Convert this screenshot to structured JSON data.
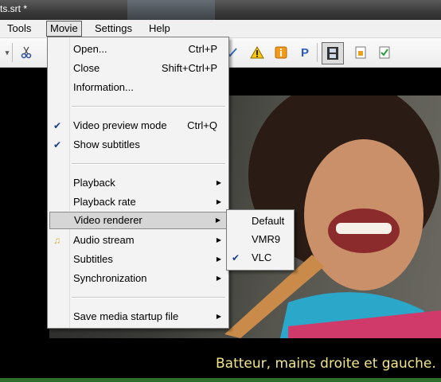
{
  "window": {
    "title": "ts.srt *"
  },
  "menubar": {
    "items": [
      {
        "label": "Tools",
        "key": "T"
      },
      {
        "label": "Movie",
        "key": "M"
      },
      {
        "label": "Settings",
        "key": "S"
      },
      {
        "label": "Help",
        "key": "H"
      }
    ]
  },
  "movie_menu": {
    "open": {
      "label": "Open...",
      "shortcut": "Ctrl+P"
    },
    "close": {
      "label": "Close",
      "shortcut": "Shift+Ctrl+P"
    },
    "information": {
      "label": "Information..."
    },
    "video_preview_mode": {
      "label": "Video preview mode",
      "shortcut": "Ctrl+Q",
      "checked": true
    },
    "show_subtitles": {
      "label": "Show subtitles",
      "checked": true
    },
    "playback": {
      "label": "Playback"
    },
    "playback_rate": {
      "label": "Playback rate"
    },
    "video_renderer": {
      "label": "Video renderer"
    },
    "audio_stream": {
      "label": "Audio stream"
    },
    "subtitles": {
      "label": "Subtitles"
    },
    "synchronization": {
      "label": "Synchronization"
    },
    "save_media_startup_file": {
      "label": "Save media startup file"
    }
  },
  "renderer_submenu": {
    "items": [
      {
        "label": "Default",
        "checked": false
      },
      {
        "label": "VMR9",
        "checked": false
      },
      {
        "label": "VLC",
        "checked": true
      }
    ]
  },
  "video": {
    "subtitle_text": "Batteur, mains droite et gauche."
  },
  "icons": {
    "check": "✔",
    "submenu_arrow": "▶",
    "warning": "⚠",
    "info": "i",
    "p": "P"
  }
}
